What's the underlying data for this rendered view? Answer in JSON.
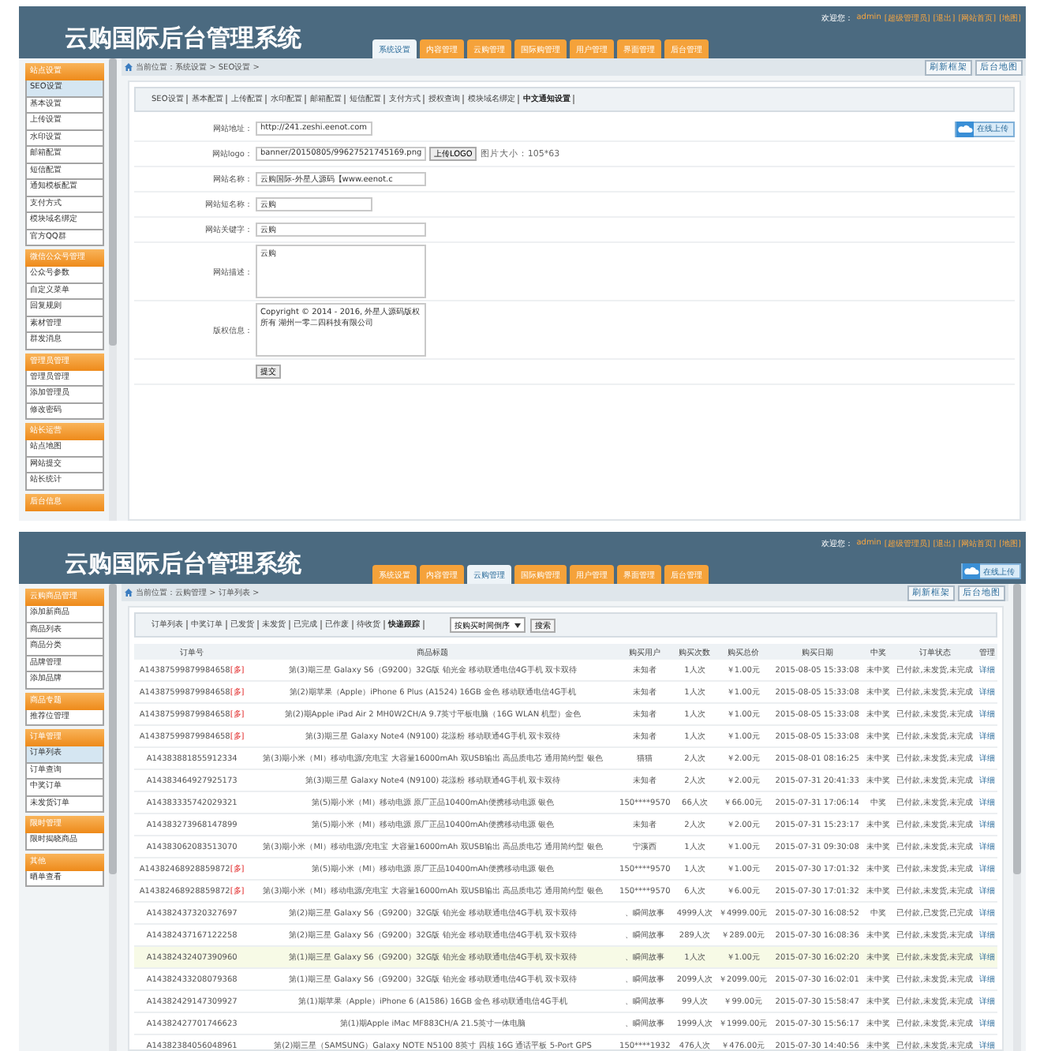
{
  "panels": [
    {
      "kind": "form",
      "header": {
        "title": "云购国际后台管理系统",
        "welcome": "欢迎您：",
        "user": "admin",
        "links": [
          "[超级管理员]",
          "[退出]",
          "[网站首页]",
          "[地图]"
        ]
      },
      "tabs": [
        {
          "label": "系统设置",
          "selected": true
        },
        {
          "label": "内容管理",
          "selected": false
        },
        {
          "label": "云购管理",
          "selected": false
        },
        {
          "label": "国际购管理",
          "selected": false
        },
        {
          "label": "用户管理",
          "selected": false
        },
        {
          "label": "界面管理",
          "selected": false
        },
        {
          "label": "后台管理",
          "selected": false
        }
      ],
      "sidebar": [
        {
          "title": "站点设置",
          "items": [
            {
              "label": "SEO设置",
              "selected": true
            },
            {
              "label": "基本设置",
              "selected": false
            },
            {
              "label": "上传设置",
              "selected": false
            },
            {
              "label": "水印设置",
              "selected": false
            },
            {
              "label": "邮箱配置",
              "selected": false
            },
            {
              "label": "短信配置",
              "selected": false
            },
            {
              "label": "通知模板配置",
              "selected": false
            },
            {
              "label": "支付方式",
              "selected": false
            },
            {
              "label": "模块域名绑定",
              "selected": false
            },
            {
              "label": "官方QQ群",
              "selected": false
            }
          ]
        },
        {
          "title": "微信公众号管理",
          "items": [
            {
              "label": "公众号参数",
              "selected": false
            },
            {
              "label": "自定义菜单",
              "selected": false
            },
            {
              "label": "回复规则",
              "selected": false
            },
            {
              "label": "素材管理",
              "selected": false
            },
            {
              "label": "群发消息",
              "selected": false
            }
          ]
        },
        {
          "title": "管理员管理",
          "items": [
            {
              "label": "管理员管理",
              "selected": false
            },
            {
              "label": "添加管理员",
              "selected": false
            },
            {
              "label": "修改密码",
              "selected": false
            }
          ]
        },
        {
          "title": "站长运营",
          "items": [
            {
              "label": "站点地图",
              "selected": false
            },
            {
              "label": "网站提交",
              "selected": false
            },
            {
              "label": "站长统计",
              "selected": false
            }
          ]
        },
        {
          "title": "后台信息"
        }
      ],
      "breadcrumb": "当前位置：系统设置 > SEO设置 >",
      "toolbar_buttons": [
        "刷新框架",
        "后台地图"
      ],
      "subnav": [
        {
          "label": "SEO设置",
          "selected": false
        },
        {
          "label": "基本配置",
          "selected": false
        },
        {
          "label": "上传配置",
          "selected": false
        },
        {
          "label": "水印配置",
          "selected": false
        },
        {
          "label": "邮箱配置",
          "selected": false
        },
        {
          "label": "短信配置",
          "selected": false
        },
        {
          "label": "支付方式",
          "selected": false
        },
        {
          "label": "授权查询",
          "selected": false
        },
        {
          "label": "模块域名绑定",
          "selected": false
        },
        {
          "label": "中文通知设置",
          "selected": true
        }
      ],
      "form": {
        "online_upload": "在线上传",
        "rows": [
          {
            "kind": "short_input",
            "label": "网站地址：",
            "value": "http://241.zeshi.eenot.com"
          },
          {
            "kind": "upload_input",
            "label": "网站logo：",
            "value": "banner/20150805/99627521745169.png",
            "button": "上传LOGO",
            "hint": "图片大小：105*63"
          },
          {
            "kind": "long_input",
            "label": "网站名称：",
            "value": "云购国际-外星人源码【www.eenot.c"
          },
          {
            "kind": "short_input",
            "label": "网站短名称：",
            "value": "云购"
          },
          {
            "kind": "long_input",
            "label": "网站关键字：",
            "value": "云购"
          },
          {
            "kind": "textarea",
            "label": "网站描述：",
            "value": "云购"
          },
          {
            "kind": "textarea",
            "label": "版权信息：",
            "value": "Copyright © 2014 - 2016, 外星人源码版权所有 湖州一零二四科技有限公司"
          },
          {
            "kind": "submit",
            "button": "提交"
          }
        ]
      }
    },
    {
      "kind": "table",
      "header": {
        "title": "云购国际后台管理系统",
        "welcome": "欢迎您：",
        "user": "admin",
        "links": [
          "[超级管理员]",
          "[退出]",
          "[网站首页]",
          "[地图]"
        ],
        "upload_button": "在线上传"
      },
      "tabs": [
        {
          "label": "系统设置",
          "selected": false
        },
        {
          "label": "内容管理",
          "selected": false
        },
        {
          "label": "云购管理",
          "selected": true
        },
        {
          "label": "国际购管理",
          "selected": false
        },
        {
          "label": "用户管理",
          "selected": false
        },
        {
          "label": "界面管理",
          "selected": false
        },
        {
          "label": "后台管理",
          "selected": false
        }
      ],
      "sidebar": [
        {
          "title": "云购商品管理",
          "items": [
            {
              "label": "添加新商品",
              "selected": false
            },
            {
              "label": "商品列表",
              "selected": false
            },
            {
              "label": "商品分类",
              "selected": false
            },
            {
              "label": "品牌管理",
              "selected": false
            },
            {
              "label": "添加品牌",
              "selected": false
            }
          ]
        },
        {
          "title": "商品专题",
          "items": [
            {
              "label": "推荐位管理",
              "selected": false
            }
          ]
        },
        {
          "title": "订单管理",
          "items": [
            {
              "label": "订单列表",
              "selected": true
            },
            {
              "label": "订单查询",
              "selected": false
            },
            {
              "label": "中奖订单",
              "selected": false
            },
            {
              "label": "未发货订单",
              "selected": false
            }
          ]
        },
        {
          "title": "限时管理",
          "items": [
            {
              "label": "限时揭晓商品",
              "selected": false
            }
          ]
        },
        {
          "title": "其他",
          "items": [
            {
              "label": "晒单查看",
              "selected": false
            }
          ]
        }
      ],
      "breadcrumb": "当前位置：云购管理 > 订单列表 >",
      "toolbar_buttons": [
        "刷新框架",
        "后台地图"
      ],
      "subnav": [
        {
          "label": "订单列表",
          "selected": false
        },
        {
          "label": "中奖订单",
          "selected": false
        },
        {
          "label": "已发货",
          "selected": false
        },
        {
          "label": "未发货",
          "selected": false
        },
        {
          "label": "已完成",
          "selected": false
        },
        {
          "label": "已作废",
          "selected": false
        },
        {
          "label": "待收货",
          "selected": false
        },
        {
          "label": "快递跟踪",
          "selected": true
        }
      ],
      "sort_select": "按购买时间倒序",
      "search_button": "搜索",
      "table": {
        "columns": [
          "订单号",
          "商品标题",
          "购买用户",
          "购买次数",
          "购买总价",
          "购买日期",
          "中奖",
          "订单状态",
          "管理"
        ],
        "rows": [
          {
            "order": "A14387599879984658",
            "tag": "[多]",
            "title": "第(3)期三星 Galaxy S6（G9200）32G版 铂光金 移动联通电信4G手机 双卡双待",
            "user": "未知者",
            "times": "1人次",
            "total": "￥1.00元",
            "date": "2015-08-05 15:33:08",
            "win": "未中奖",
            "status": "已付款,未发货,未完成",
            "action": "详细",
            "highlighted": false
          },
          {
            "order": "A14387599879984658",
            "tag": "[多]",
            "title": "第(2)期苹果（Apple）iPhone 6 Plus (A1524) 16GB 金色 移动联通电信4G手机",
            "user": "未知者",
            "times": "1人次",
            "total": "￥1.00元",
            "date": "2015-08-05 15:33:08",
            "win": "未中奖",
            "status": "已付款,未发货,未完成",
            "action": "详细",
            "highlighted": false
          },
          {
            "order": "A14387599879984658",
            "tag": "[多]",
            "title": "第(2)期Apple iPad Air 2 MH0W2CH/A 9.7英寸平板电脑（16G WLAN 机型）金色",
            "user": "未知者",
            "times": "1人次",
            "total": "￥1.00元",
            "date": "2015-08-05 15:33:08",
            "win": "未中奖",
            "status": "已付款,未发货,未完成",
            "action": "详细",
            "highlighted": false
          },
          {
            "order": "A14387599879984658",
            "tag": "[多]",
            "title": "第(3)期三星 Galaxy Note4 (N9100) 花漾粉 移动联通4G手机 双卡双待",
            "user": "未知者",
            "times": "1人次",
            "total": "￥1.00元",
            "date": "2015-08-05 15:33:08",
            "win": "未中奖",
            "status": "已付款,未发货,未完成",
            "action": "详细",
            "highlighted": false
          },
          {
            "order": "A14383881855912334",
            "title": "第(3)期小米（MI）移动电源/充电宝 大容量16000mAh 双USB输出 高品质电芯 通用简约型 银色",
            "user": "猫猫",
            "times": "2人次",
            "total": "￥2.00元",
            "date": "2015-08-01 08:16:25",
            "win": "未中奖",
            "status": "已付款,未发货,未完成",
            "action": "详细",
            "highlighted": false
          },
          {
            "order": "A14383464927925173",
            "title": "第(3)期三星 Galaxy Note4 (N9100) 花漾粉 移动联通4G手机 双卡双待",
            "user": "未知者",
            "times": "2人次",
            "total": "￥2.00元",
            "date": "2015-07-31 20:41:33",
            "win": "未中奖",
            "status": "已付款,未发货,未完成",
            "action": "详细",
            "highlighted": false
          },
          {
            "order": "A14383335742029321",
            "title": "第(5)期小米（MI）移动电源 原厂正品10400mAh便携移动电源 银色",
            "user": "150****9570",
            "times": "66人次",
            "total": "￥66.00元",
            "date": "2015-07-31 17:06:14",
            "win": "中奖",
            "status": "已付款,未发货,未完成",
            "action": "详细",
            "highlighted": false
          },
          {
            "order": "A14383273968147899",
            "title": "第(5)期小米（MI）移动电源 原厂正品10400mAh便携移动电源 银色",
            "user": "未知者",
            "times": "2人次",
            "total": "￥2.00元",
            "date": "2015-07-31 15:23:17",
            "win": "未中奖",
            "status": "已付款,未发货,未完成",
            "action": "详细",
            "highlighted": false
          },
          {
            "order": "A14383062083513070",
            "title": "第(3)期小米（MI）移动电源/充电宝 大容量16000mAh 双USB输出 高品质电芯 通用简约型 银色",
            "user": "宁溪西",
            "times": "1人次",
            "total": "￥1.00元",
            "date": "2015-07-31 09:30:08",
            "win": "未中奖",
            "status": "已付款,未发货,未完成",
            "action": "详细",
            "highlighted": false
          },
          {
            "order": "A14382468928859872",
            "tag": "[多]",
            "title": "第(5)期小米（MI）移动电源 原厂正品10400mAh便携移动电源 银色",
            "user": "150****9570",
            "times": "1人次",
            "total": "￥1.00元",
            "date": "2015-07-30 17:01:32",
            "win": "未中奖",
            "status": "已付款,未发货,未完成",
            "action": "详细",
            "highlighted": false
          },
          {
            "order": "A14382468928859872",
            "tag": "[多]",
            "title": "第(3)期小米（MI）移动电源/充电宝 大容量16000mAh 双USB输出 高品质电芯 通用简约型 银色",
            "user": "150****9570",
            "times": "6人次",
            "total": "￥6.00元",
            "date": "2015-07-30 17:01:32",
            "win": "未中奖",
            "status": "已付款,未发货,未完成",
            "action": "详细",
            "highlighted": false
          },
          {
            "order": "A14382437320327697",
            "title": "第(2)期三星 Galaxy S6（G9200）32G版 铂光金 移动联通电信4G手机 双卡双待",
            "user": "、瞬间故事",
            "times": "4999人次",
            "total": "￥4999.00元",
            "date": "2015-07-30 16:08:52",
            "win": "中奖",
            "status": "已付款,已发货,已完成",
            "action": "详细",
            "highlighted": false
          },
          {
            "order": "A14382437167122258",
            "title": "第(2)期三星 Galaxy S6（G9200）32G版 铂光金 移动联通电信4G手机 双卡双待",
            "user": "、瞬间故事",
            "times": "289人次",
            "total": "￥289.00元",
            "date": "2015-07-30 16:08:36",
            "win": "未中奖",
            "status": "已付款,未发货,未完成",
            "action": "详细",
            "highlighted": false
          },
          {
            "order": "A14382432407390960",
            "title": "第(1)期三星 Galaxy S6（G9200）32G版 铂光金 移动联通电信4G手机 双卡双待",
            "user": "、瞬间故事",
            "times": "1人次",
            "total": "￥1.00元",
            "date": "2015-07-30 16:02:20",
            "win": "未中奖",
            "status": "已付款,未发货,未完成",
            "action": "详细",
            "highlighted": true
          },
          {
            "order": "A14382433208079368",
            "title": "第(1)期三星 Galaxy S6（G9200）32G版 铂光金 移动联通电信4G手机 双卡双待",
            "user": "、瞬间故事",
            "times": "2099人次",
            "total": "￥2099.00元",
            "date": "2015-07-30 16:02:01",
            "win": "未中奖",
            "status": "已付款,未发货,未完成",
            "action": "详细",
            "highlighted": false
          },
          {
            "order": "A14382429147309927",
            "title": "第(1)期苹果（Apple）iPhone 6 (A1586) 16GB 金色 移动联通电信4G手机",
            "user": "、瞬间故事",
            "times": "99人次",
            "total": "￥99.00元",
            "date": "2015-07-30 15:58:47",
            "win": "未中奖",
            "status": "已付款,未发货,未完成",
            "action": "详细",
            "highlighted": false
          },
          {
            "order": "A14382427701746623",
            "title": "第(1)期Apple iMac MF883CH/A 21.5英寸一体电脑",
            "user": "、瞬间故事",
            "times": "1999人次",
            "total": "￥1999.00元",
            "date": "2015-07-30 15:56:17",
            "win": "未中奖",
            "status": "已付款,未发货,未完成",
            "action": "详细",
            "highlighted": false
          },
          {
            "order": "A14382384056048961",
            "title": "第(2)期三星（SAMSUNG）Galaxy NOTE N5100 8英寸 四核 16G 通话平板 5-Port GPS",
            "user": "150****1932",
            "times": "476人次",
            "total": "￥476.00元",
            "date": "2015-07-30 14:40:56",
            "win": "未中奖",
            "status": "已付款,未发货,未完成",
            "action": "详细",
            "highlighted": false
          }
        ]
      }
    }
  ]
}
